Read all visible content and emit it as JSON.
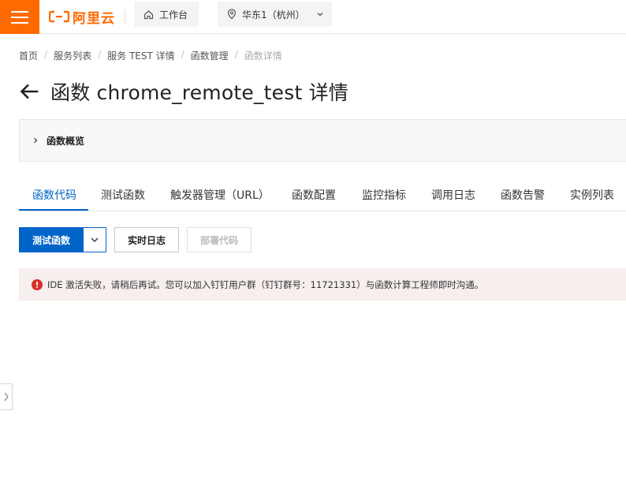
{
  "topbar": {
    "logo_text": "阿里云",
    "workbench_label": "工作台",
    "region_label": "华东1（杭州）"
  },
  "breadcrumb": {
    "items": [
      "首页",
      "服务列表",
      "服务 TEST 详情",
      "函数管理",
      "函数详情"
    ],
    "separator": "/"
  },
  "page": {
    "title": "函数 chrome_remote_test 详情"
  },
  "overview": {
    "label": "函数概览"
  },
  "tabs": {
    "items": [
      "函数代码",
      "测试函数",
      "触发器管理（URL）",
      "函数配置",
      "监控指标",
      "调用日志",
      "函数告警",
      "实例列表"
    ],
    "active_index": 0
  },
  "actions": {
    "test_label": "测试函数",
    "realtime_log_label": "实时日志",
    "deploy_label": "部署代码"
  },
  "alert": {
    "message": "IDE 激活失败，请稍后再试。您可以加入钉钉用户群（钉钉群号：11721331）与函数计算工程师即时沟通。"
  },
  "colors": {
    "brand_orange": "#ff6a00",
    "primary_blue": "#0064c8",
    "error_red": "#d93026",
    "alert_bg": "#f7eeee"
  }
}
